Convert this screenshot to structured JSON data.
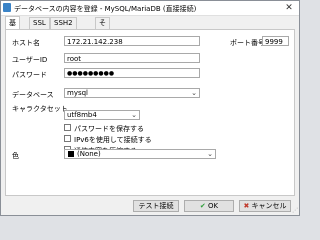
{
  "window": {
    "title": "データベースの内容を登録 - MySQL/MariaDB (直接接続)",
    "close_glyph": "✕"
  },
  "tabs": [
    {
      "label": "基本",
      "active": true
    },
    {
      "label": "SSL",
      "active": false
    },
    {
      "label": "SSH2トンネル",
      "active": false
    },
    {
      "label": "その他",
      "active": false
    }
  ],
  "form": {
    "host_label": "ホスト名",
    "host_value": "172.21.142.238",
    "port_label": "ポート番号",
    "port_value": "9999",
    "user_label": "ユーザーID",
    "user_value": "root",
    "password_label": "パスワード",
    "password_value": "●●●●●●●●●",
    "database_label": "データベース",
    "database_value": "mysql",
    "charset_label": "キャラクタセット",
    "charset_value": "utf8mb4",
    "save_password_label": "パスワードを保存する",
    "ipv6_label": "IPv6を使用して接続する",
    "compress_label": "通信内容を圧縮する",
    "color_label": "色",
    "color_value": "(None)",
    "dropdown_glyph": "⌄"
  },
  "buttons": {
    "test_label": "テスト接続",
    "ok_label": "OK",
    "ok_glyph": "✔",
    "cancel_label": "キャンセル",
    "cancel_glyph": "✖"
  }
}
